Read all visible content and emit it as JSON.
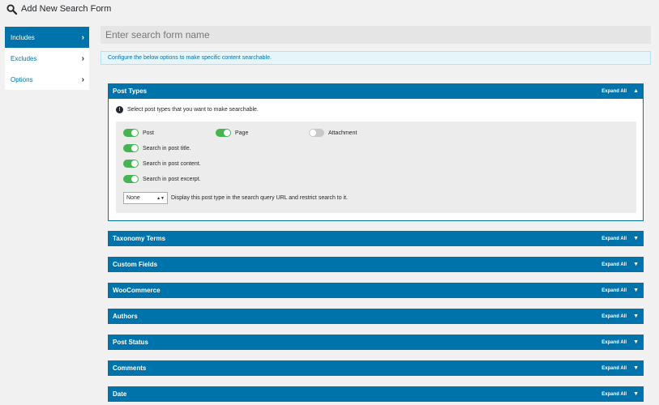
{
  "page": {
    "title": "Add New Search Form"
  },
  "sidebar": {
    "items": [
      {
        "label": "Includes",
        "active": true
      },
      {
        "label": "Excludes",
        "active": false
      },
      {
        "label": "Options",
        "active": false
      }
    ]
  },
  "form": {
    "name_placeholder": "Enter search form name",
    "name_value": ""
  },
  "notice": {
    "text": "Configure the below options to make specific content searchable."
  },
  "panels": {
    "expand_label": "Expand All",
    "post_types": {
      "title": "Post Types",
      "help": "Select post types that you want to make searchable.",
      "toggles": {
        "post": {
          "label": "Post",
          "on": true
        },
        "page": {
          "label": "Page",
          "on": true
        },
        "attachment": {
          "label": "Attachment",
          "on": false
        },
        "title": {
          "label": "Search in post title.",
          "on": true
        },
        "content": {
          "label": "Search in post content.",
          "on": true
        },
        "excerpt": {
          "label": "Search in post excerpt.",
          "on": true
        }
      },
      "select": {
        "value": "None",
        "description": "Display this post type in the search query URL and restrict search to it."
      }
    },
    "collapsed": [
      {
        "title": "Taxonomy Terms"
      },
      {
        "title": "Custom Fields"
      },
      {
        "title": "WooCommerce"
      },
      {
        "title": "Authors"
      },
      {
        "title": "Post Status"
      },
      {
        "title": "Comments"
      },
      {
        "title": "Date"
      }
    ]
  },
  "colors": {
    "accent": "#0073aa",
    "toggle_on": "#46b450",
    "toggle_off": "#c8c8c8",
    "notice_bg": "#e5f5fa"
  },
  "icons": {
    "page_title": "search-icon",
    "sidebar": "chevron-right-icon",
    "panel_open": "caret-up-icon",
    "panel_closed": "caret-down-icon",
    "help": "exclamation-icon"
  }
}
